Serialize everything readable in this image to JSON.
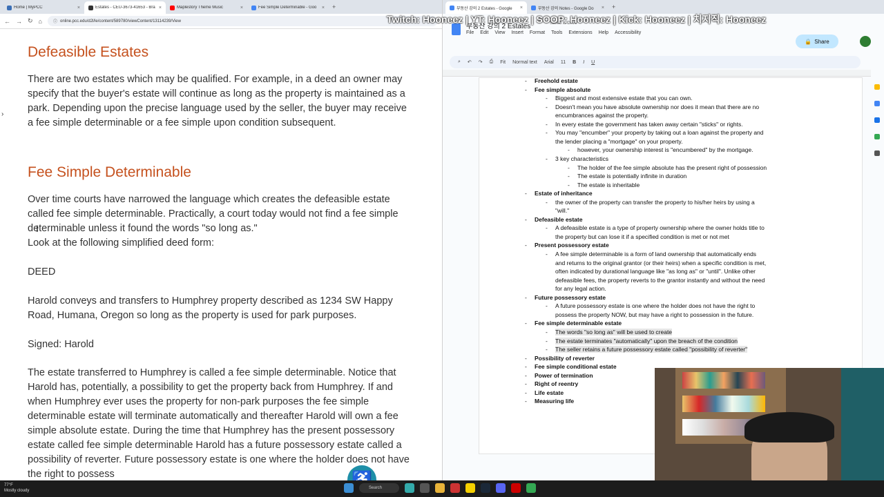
{
  "left_browser": {
    "tabs": [
      {
        "title": "Home | MyPCC",
        "color": "#3b6fb6"
      },
      {
        "title": "Estates - CEU-3673-41653 - Bra",
        "color": "#333333",
        "active": true
      },
      {
        "title": "Maplestory Theme Music",
        "color": "#ff0000"
      },
      {
        "title": "Fee Simple Determinable - Goo",
        "color": "#4285f4"
      }
    ],
    "url": "online.pcc.edu/d2l/le/content/589780/viewContent/13114239/View"
  },
  "article": {
    "heading1": "Defeasible Estates",
    "para1": "There are two estates which may be qualified. For example, in a deed an owner may specify that the buyer's estate will continue as long as the property is maintained as a park. Depending upon the precise language used by the seller, the buyer may receive a fee simple determinable or a fee simple upon condition subsequent.",
    "heading2": "Fee Simple Determinable",
    "para2": "Over time courts have narrowed the language which creates the defeasible estate called fee simple determinable. Practically, a court today would not find a fee simple determinable unless it found the words \"so long as.\"",
    "para3": "Look at the following simplified deed form:",
    "deed_label": "DEED",
    "para4": "Harold conveys and transfers to Humphrey property described as 1234 SW Happy Road, Humana, Oregon so long as the property is used for park purposes.",
    "signed": "Signed: Harold",
    "para5": "The estate transferred to Humphrey is called a fee simple determinable. Notice that Harold has, potentially, a possibility to get the property back from Humphrey. If and when Humphrey ever uses the property for non-park purposes the fee simple determinable estate will terminate automatically and thereafter Harold will own a fee simple absolute estate. During the time that Humphrey has the present possessory estate called fee simple determinable Harold has a future possessory estate called a possibility of reverter. Future possessory estate is one where the holder does not have the right to possess"
  },
  "stream_overlay": "Twitch: Hooneez | YT: Hooneez | SOOP: Hooneez | Kick: Hooneez | 치지직: Hooneez",
  "right_browser": {
    "tabs": [
      {
        "title": "부동산 강의 2 Estates - Google",
        "color": "#4285f4",
        "active": true
      },
      {
        "title": "부동산 강의 Notes - Google Do",
        "color": "#4285f4"
      }
    ],
    "doc_title": "부동산 강의 2 Estates",
    "saved": "Saved to Drive",
    "menu": [
      "File",
      "Edit",
      "View",
      "Insert",
      "Format",
      "Tools",
      "Extensions",
      "Help",
      "Accessibility"
    ],
    "share": "Share",
    "toolbar": {
      "zoom": "Fit",
      "style": "Normal text",
      "font": "Arial",
      "size": "11"
    }
  },
  "doc_lines": [
    {
      "t": "Freehold estate",
      "b": true,
      "lvl": 0
    },
    {
      "t": "Fee simple absolute",
      "b": true,
      "lvl": 0
    },
    {
      "t": "Biggest and most extensive estate that you can own.",
      "lvl": 1
    },
    {
      "t": "Doesn't mean you have absolute ownership nor does it mean that there are no",
      "lvl": 1
    },
    {
      "t": "encumbrances against the property.",
      "lvl": 1,
      "cont": true
    },
    {
      "t": "In every estate the government has taken away certain \"sticks\" or rights.",
      "lvl": 1
    },
    {
      "t": "You may \"encumber\" your property by taking out a loan against the property and",
      "lvl": 1
    },
    {
      "t": "the lender placing a \"mortgage\" on your property.",
      "lvl": 1,
      "cont": true
    },
    {
      "t": "however, your ownership interest is \"encumbered\" by the mortgage.",
      "lvl": 2,
      "u": "however"
    },
    {
      "t": "3 key characteristics",
      "lvl": 1
    },
    {
      "t": "The holder of the fee simple absolute has the present right of possession",
      "lvl": 2
    },
    {
      "t": "The estate is potentially infinite in duration",
      "lvl": 2
    },
    {
      "t": "The estate is inheritable",
      "lvl": 2
    },
    {
      "t": "Estate of inheritance",
      "b": true,
      "lvl": 0
    },
    {
      "t": "the owner of the property can transfer the property to his/her heirs by using a",
      "lvl": 1
    },
    {
      "t": "\"will.\"",
      "lvl": 1,
      "cont": true
    },
    {
      "t": "Defeasible estate",
      "b": true,
      "lvl": 0
    },
    {
      "t": "A defeasible estate is a type of property ownership where the owner holds title to",
      "lvl": 1
    },
    {
      "t": "the property but can lose it if a specified condition is met or not met",
      "lvl": 1,
      "cont": true
    },
    {
      "t": "Present possessory estate",
      "b": true,
      "lvl": 0
    },
    {
      "t": "A fee simple determinable is a form of land ownership that automatically ends",
      "lvl": 1
    },
    {
      "t": "and returns to the original grantor (or their heirs) when a specific condition is met,",
      "lvl": 1,
      "cont": true
    },
    {
      "t": "often indicated by durational language like \"as long as\" or \"until\". Unlike other",
      "lvl": 1,
      "cont": true
    },
    {
      "t": "defeasible fees, the property reverts to the grantor instantly and without the need",
      "lvl": 1,
      "cont": true
    },
    {
      "t": "for any legal action.",
      "lvl": 1,
      "cont": true
    },
    {
      "t": "Future possessory estate",
      "b": true,
      "lvl": 0
    },
    {
      "t": "A future possessory estate is one where the holder does not have the right to",
      "lvl": 1
    },
    {
      "t": "possess the property NOW, but may have a right to possession in the future.",
      "lvl": 1,
      "cont": true
    },
    {
      "t": "Fee simple determinable estate",
      "b": true,
      "lvl": 0
    },
    {
      "t": "The words \"so long as\" will be used to create",
      "lvl": 1,
      "hl": true
    },
    {
      "t": "The estate terminates \"automatically\" upon the breach of the condition",
      "lvl": 1,
      "hl": true
    },
    {
      "t": "The seller retains a future possessory estate called \"possibility of reverter\"",
      "lvl": 1,
      "hl": true
    },
    {
      "t": "Possibility of reverter",
      "b": true,
      "lvl": 0
    },
    {
      "t": "Fee simple conditional estate",
      "b": true,
      "lvl": 0
    },
    {
      "t": "Power of termination",
      "b": true,
      "lvl": 0
    },
    {
      "t": "Right of reentry",
      "b": true,
      "lvl": 0
    },
    {
      "t": "Life estate",
      "b": true,
      "lvl": 0
    },
    {
      "t": "Measuring life",
      "b": true,
      "lvl": 0
    }
  ],
  "taskbar": {
    "temp": "77°F",
    "weather": "Mostly cloudy",
    "search": "Search"
  }
}
